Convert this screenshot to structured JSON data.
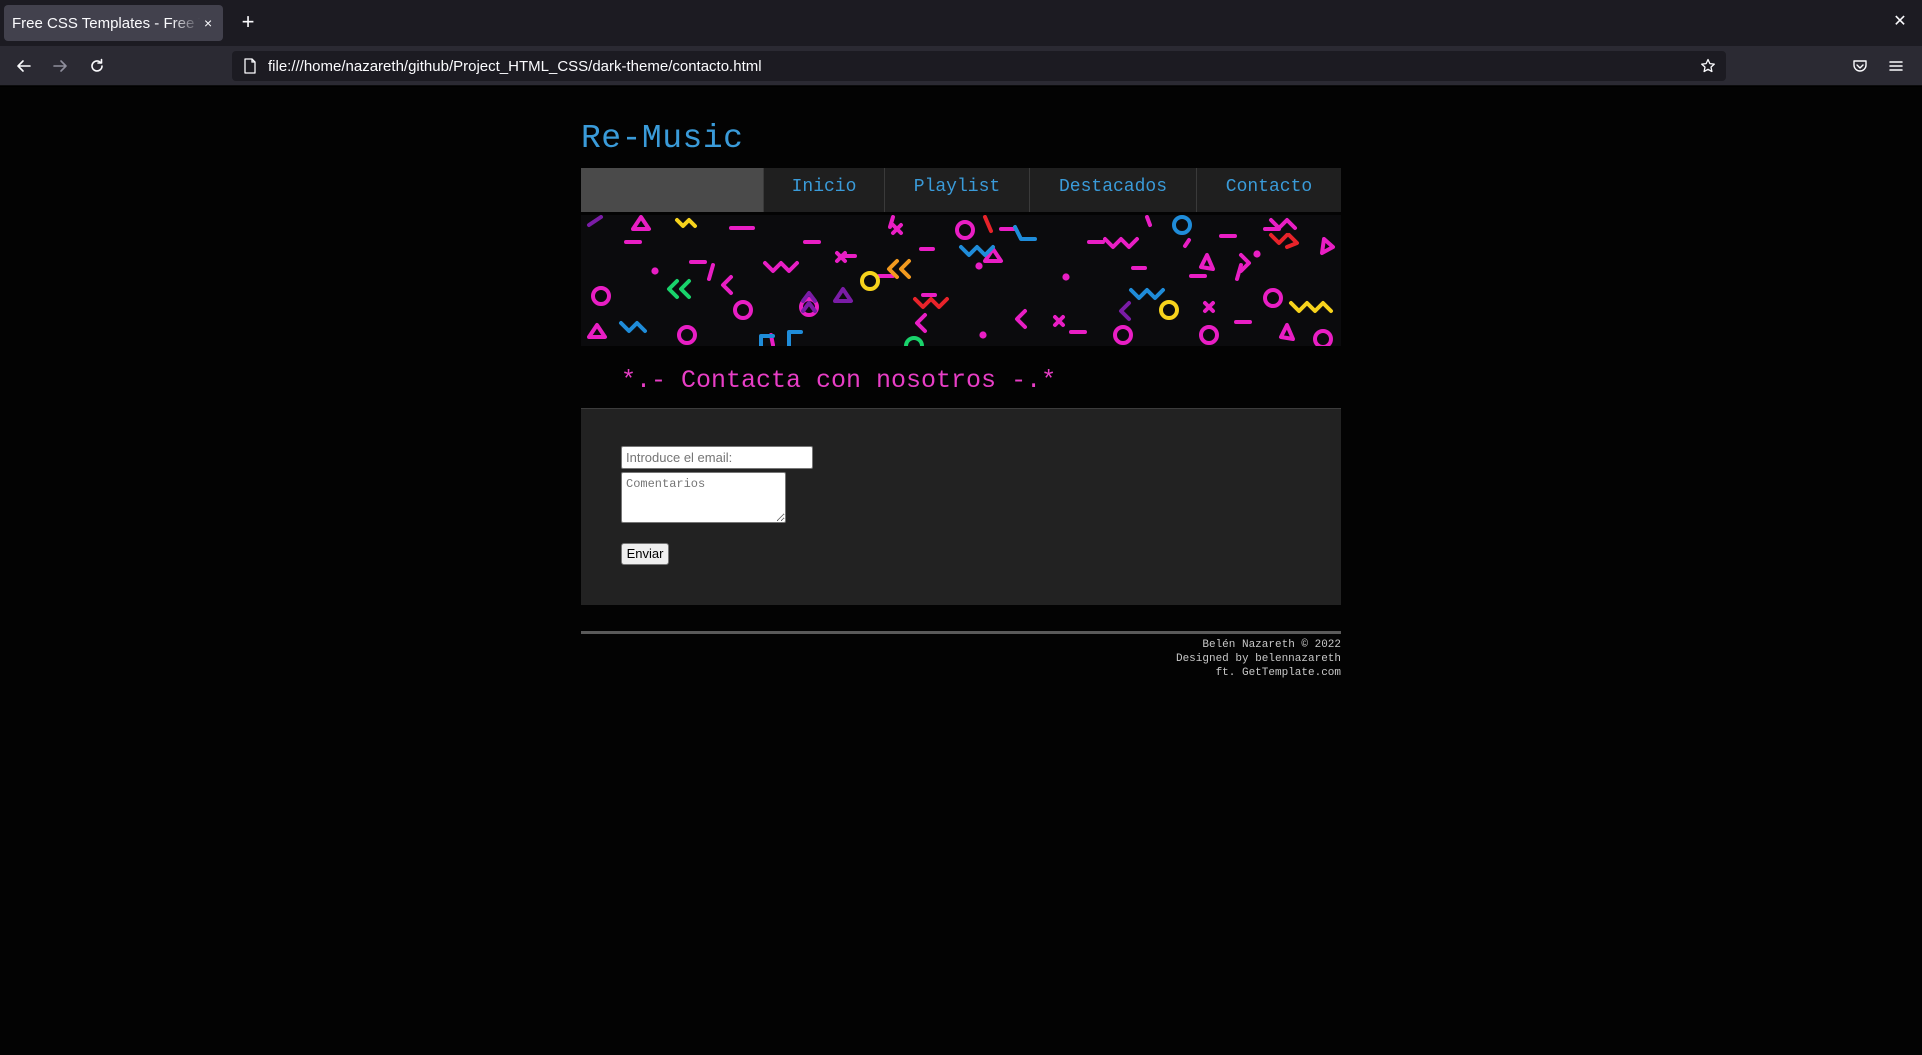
{
  "browser": {
    "tab_title": "Free CSS Templates - Free Templates",
    "tab_close": "×",
    "new_tab": "+",
    "window_close": "✕",
    "url": "file:///home/nazareth/github/Project_HTML_CSS/dark-theme/contacto.html",
    "icons": [
      "back-arrow-icon",
      "forward-arrow-icon",
      "reload-icon",
      "page-icon",
      "bookmark-star-icon",
      "pocket-icon",
      "hamburger-menu-icon"
    ]
  },
  "site": {
    "logo": "Re-Music",
    "menu": [
      {
        "label": "Inicio"
      },
      {
        "label": "Playlist"
      },
      {
        "label": "Destacados"
      },
      {
        "label": "Contacto"
      }
    ],
    "heading": "*.- Contacta con nosotros -.*",
    "form": {
      "email_placeholder": "Introduce el email:",
      "comments_placeholder": "Comentarios",
      "submit_label": "Enviar"
    },
    "footer": {
      "line1": "Belén Nazareth © 2022",
      "line2": "Designed by belennazareth",
      "line3": "ft. GetTemplate.com"
    },
    "colors": {
      "link": "#3a9bd9",
      "heading": "#e83ec6",
      "background": "#030303"
    }
  }
}
